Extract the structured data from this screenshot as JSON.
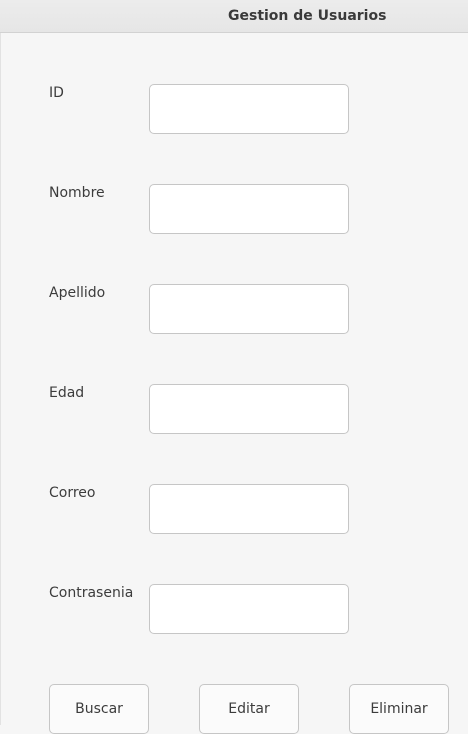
{
  "window": {
    "title": "Gestion de Usuarios"
  },
  "form": {
    "fields": [
      {
        "label": "ID",
        "value": ""
      },
      {
        "label": "Nombre",
        "value": ""
      },
      {
        "label": "Apellido",
        "value": ""
      },
      {
        "label": "Edad",
        "value": ""
      },
      {
        "label": "Correo",
        "value": ""
      },
      {
        "label": "Contrasenia",
        "value": ""
      }
    ]
  },
  "actions": {
    "buscar": "Buscar",
    "editar": "Editar",
    "eliminar": "Eliminar"
  }
}
